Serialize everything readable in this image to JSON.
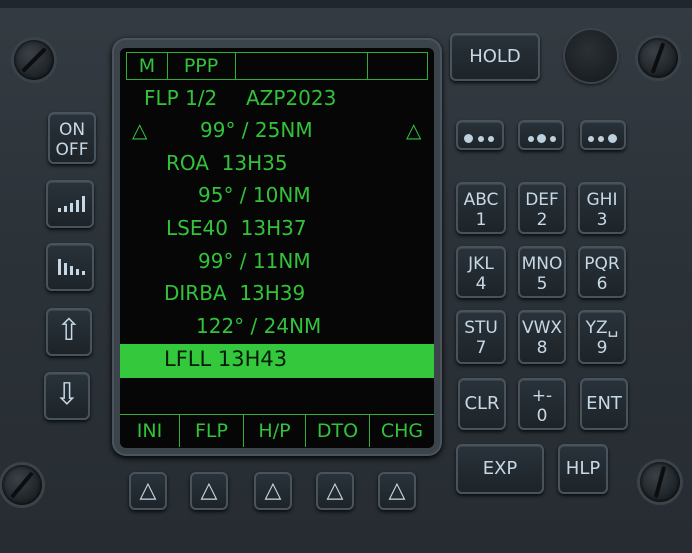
{
  "screen": {
    "topbar": [
      "M",
      "PPP",
      "",
      "",
      ""
    ],
    "header": {
      "page": "FLP 1/2",
      "route": "AZP2023"
    },
    "rows": [
      {
        "text": "99° / 25NM"
      },
      {
        "text": "ROA  13H35"
      },
      {
        "text": "95° / 10NM"
      },
      {
        "text": "LSE40  13H37"
      },
      {
        "text": "99° / 11NM"
      },
      {
        "text": "DIRBA  13H39"
      },
      {
        "text": "122° / 24NM"
      }
    ],
    "selected": "LFLL  13H43",
    "softkeys": [
      "INI",
      "FLP",
      "H/P",
      "DTO",
      "CHG"
    ],
    "tri_left": "△",
    "tri_right": "△"
  },
  "left_keys": {
    "on_off_line1": "ON",
    "on_off_line2": "OFF",
    "up_arrow": "⇧",
    "down_arrow": "⇩"
  },
  "right_keys": {
    "hold": "HOLD",
    "keypad": [
      {
        "top": "ABC",
        "bottom": "1"
      },
      {
        "top": "DEF",
        "bottom": "2"
      },
      {
        "top": "GHI",
        "bottom": "3"
      },
      {
        "top": "JKL",
        "bottom": "4"
      },
      {
        "top": "MNO",
        "bottom": "5"
      },
      {
        "top": "PQR",
        "bottom": "6"
      },
      {
        "top": "STU",
        "bottom": "7"
      },
      {
        "top": "VWX",
        "bottom": "8"
      },
      {
        "top": "YZ␣",
        "bottom": "9"
      }
    ],
    "clr": "CLR",
    "plus_minus_top": "+-",
    "plus_minus_bottom": "0",
    "ent": "ENT",
    "exp": "EXP",
    "hlp": "HLP"
  },
  "bottom_keys": [
    "△",
    "△",
    "△",
    "△",
    "△"
  ]
}
